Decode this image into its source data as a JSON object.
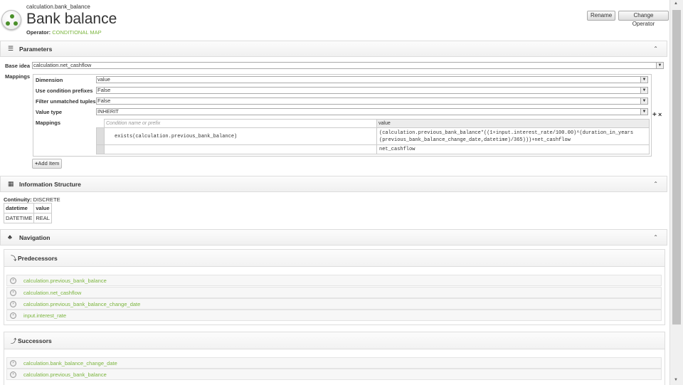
{
  "header": {
    "path": "calculation.bank_balance",
    "title": "Bank balance",
    "operator_label": "Operator:",
    "operator_value": "CONDITIONAL MAP",
    "rename_label": "Rename",
    "change_operator_label": "Change Operator"
  },
  "parameters": {
    "title": "Parameters",
    "base_idea_label": "Base idea",
    "base_idea_value": "calculation.net_cashflow",
    "mappings_label": "Mappings",
    "dimension_label": "Dimension",
    "dimension_value": "value",
    "use_prefixes_label": "Use condition prefixes",
    "use_prefixes_value": "False",
    "filter_label": "Filter unmatched tuples",
    "filter_value": "False",
    "value_type_label": "Value type",
    "value_type_value": "INHERIT",
    "inner_mappings_label": "Mappings",
    "col_condition_placeholder": "Condition name or prefix",
    "col_value": "value",
    "rows": [
      {
        "condition": "exists(calculation.previous_bank_balance)",
        "value_line1": "(calculation.previous_bank_balance*((1+input.interest_rate/100.00)^(duration_in_years",
        "value_line2": "(previous_bank_balance_change_date,datetime)/365)))+net_cashflow"
      },
      {
        "condition": "",
        "value_line1": "net_cashflow",
        "value_line2": ""
      }
    ],
    "add_item_label": "Add Item",
    "plus_label": "+",
    "x_label": "×"
  },
  "info": {
    "title": "Information Structure",
    "continuity_label": "Continuity:",
    "continuity_value": "DISCRETE",
    "headers": [
      "datetime",
      "value"
    ],
    "types": [
      "DATETIME",
      "REAL"
    ]
  },
  "navigation": {
    "title": "Navigation",
    "predecessors_title": "Predecessors",
    "predecessors": [
      "calculation.previous_bank_balance",
      "calculation.net_cashflow",
      "calculation.previous_bank_balance_change_date",
      "input.interest_rate"
    ],
    "successors_title": "Successors",
    "successors": [
      "calculation.bank_balance_change_date",
      "calculation.previous_bank_balance"
    ]
  },
  "colors": {
    "accent": "#7bb53e",
    "header_bg": "#f0f0f0"
  }
}
